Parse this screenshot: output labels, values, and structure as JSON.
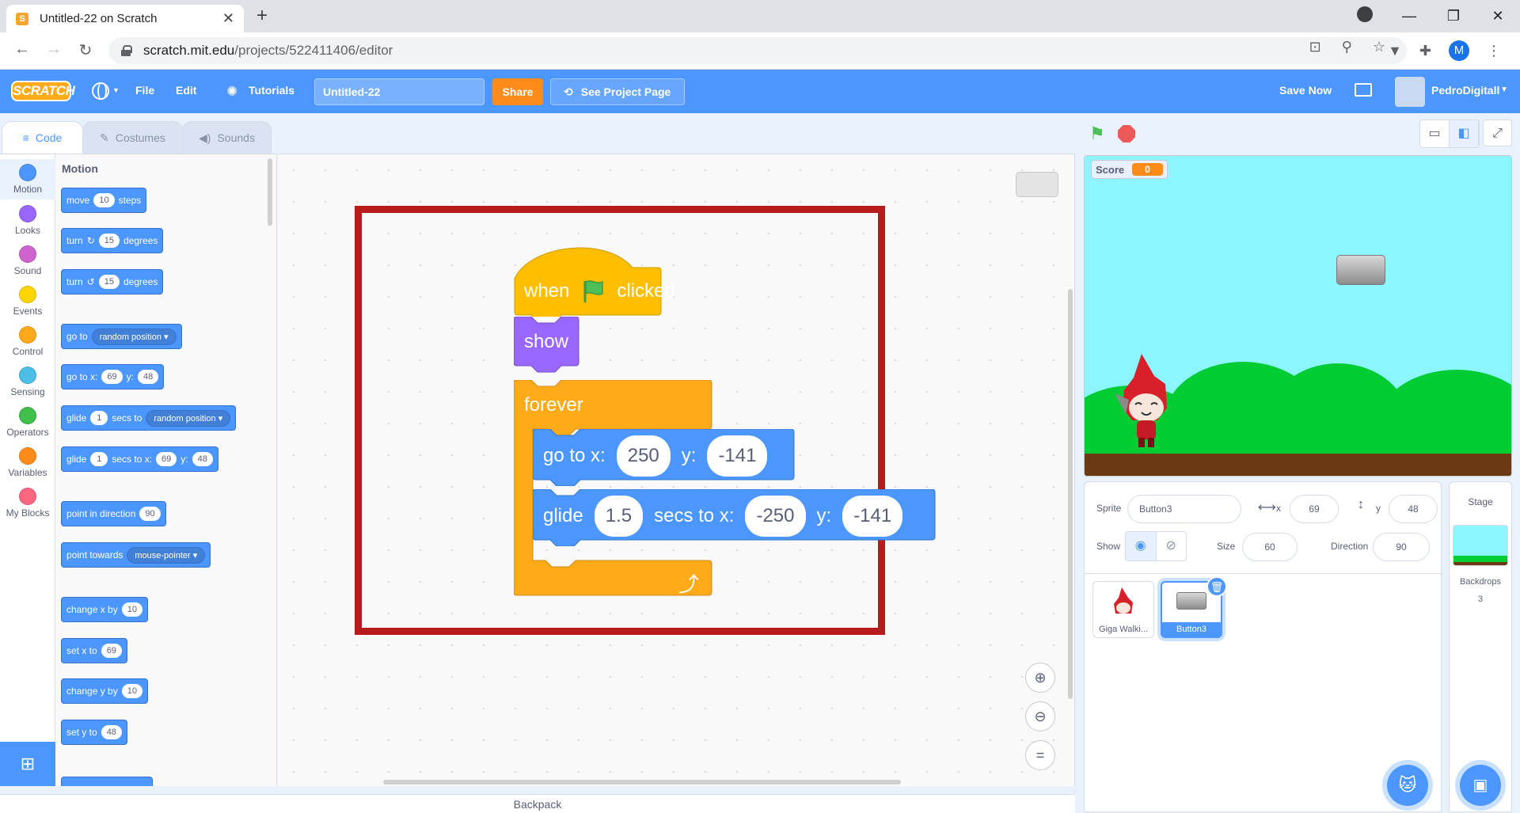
{
  "browser": {
    "tab_title": "Untitled-22 on Scratch",
    "url_host": "scratch.mit.edu",
    "url_path": "/projects/522411406/editor",
    "profile_initial": "M"
  },
  "menubar": {
    "logo": "SCRATCH",
    "file": "File",
    "edit": "Edit",
    "tutorials": "Tutorials",
    "project_title": "Untitled-22",
    "share": "Share",
    "see_project": "See Project Page",
    "save_now": "Save Now",
    "username": "PedroDigitall"
  },
  "tabs": {
    "code": "Code",
    "costumes": "Costumes",
    "sounds": "Sounds"
  },
  "categories": [
    {
      "label": "Motion",
      "color": "#4c97ff"
    },
    {
      "label": "Looks",
      "color": "#9966ff"
    },
    {
      "label": "Sound",
      "color": "#cf63cf"
    },
    {
      "label": "Events",
      "color": "#ffd500"
    },
    {
      "label": "Control",
      "color": "#ffab19"
    },
    {
      "label": "Sensing",
      "color": "#4cbfe6"
    },
    {
      "label": "Operators",
      "color": "#40bf4a"
    },
    {
      "label": "Variables",
      "color": "#ff8c1a"
    },
    {
      "label": "My Blocks",
      "color": "#ff6680"
    }
  ],
  "palette": {
    "title": "Motion",
    "move": {
      "a": "move",
      "v": "10",
      "b": "steps"
    },
    "turn_right": {
      "a": "turn",
      "v": "15",
      "b": "degrees"
    },
    "turn_left": {
      "a": "turn",
      "v": "15",
      "b": "degrees"
    },
    "goto": {
      "a": "go to",
      "dd": "random position"
    },
    "gotoxy": {
      "a": "go to x:",
      "x": "69",
      "yl": "y:",
      "y": "48"
    },
    "glide_to": {
      "a": "glide",
      "v": "1",
      "b": "secs to",
      "dd": "random position"
    },
    "glide_xy": {
      "a": "glide",
      "v": "1",
      "b": "secs to x:",
      "x": "69",
      "yl": "y:",
      "y": "48"
    },
    "point_dir": {
      "a": "point in direction",
      "v": "90"
    },
    "point_towards": {
      "a": "point towards",
      "dd": "mouse-pointer"
    },
    "change_x": {
      "a": "change x by",
      "v": "10"
    },
    "set_x": {
      "a": "set x to",
      "v": "69"
    },
    "change_y": {
      "a": "change y by",
      "v": "10"
    },
    "set_y": {
      "a": "set y to",
      "v": "48"
    }
  },
  "script": {
    "hat_when": "when",
    "hat_clicked": "clicked",
    "show": "show",
    "forever": "forever",
    "goto": {
      "label": "go to x:",
      "x": "250",
      "ylabel": "y:",
      "y": "-141"
    },
    "glide": {
      "label": "glide",
      "secs": "1.5",
      "mid": "secs to x:",
      "x": "-250",
      "ylabel": "y:",
      "y": "-141"
    }
  },
  "backpack": "Backpack",
  "stage": {
    "monitor_label": "Score",
    "monitor_value": "0"
  },
  "sprite_info": {
    "sprite_label": "Sprite",
    "sprite_name": "Button3",
    "x_label": "x",
    "x": "69",
    "y_label": "y",
    "y": "48",
    "show_label": "Show",
    "size_label": "Size",
    "size": "60",
    "direction_label": "Direction",
    "direction": "90"
  },
  "sprites": [
    {
      "name": "Giga Walki..."
    },
    {
      "name": "Button3"
    }
  ],
  "stage_pane": {
    "title": "Stage",
    "backdrops_label": "Backdrops",
    "backdrops_count": "3"
  }
}
